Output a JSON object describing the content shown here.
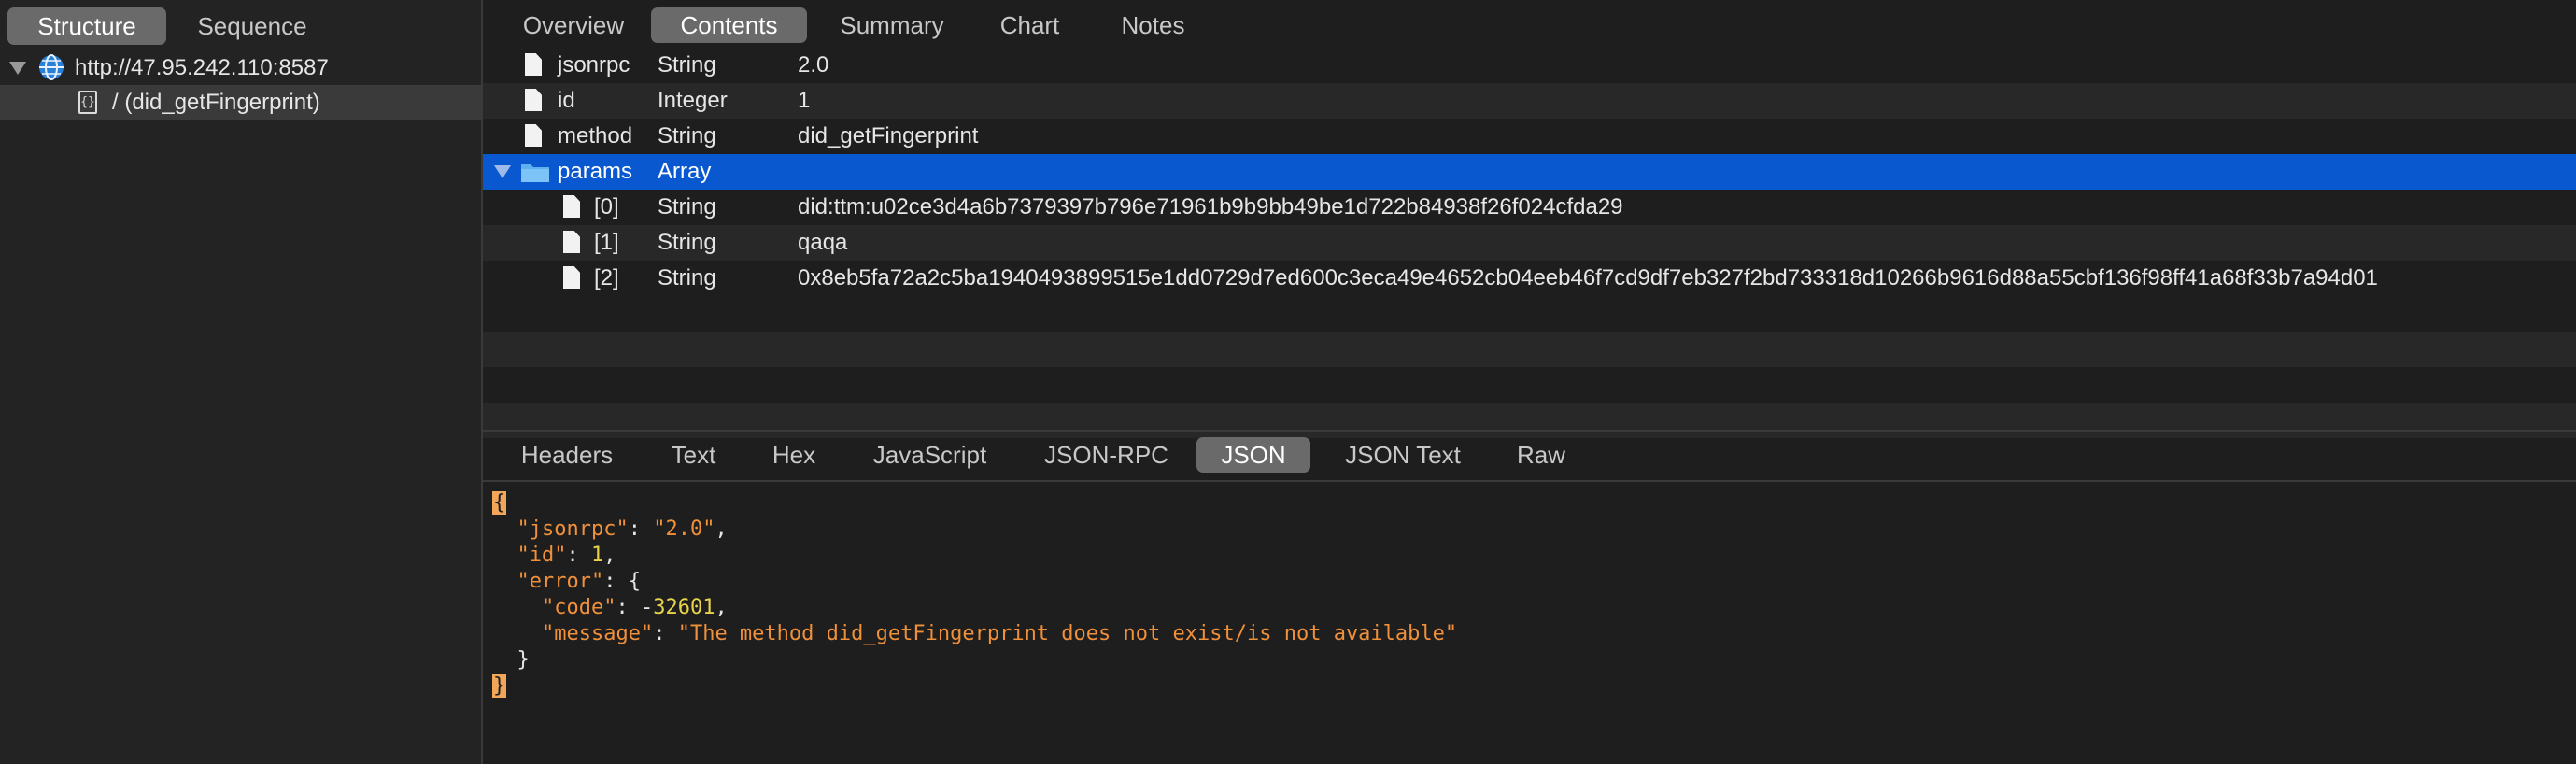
{
  "sidebar": {
    "segments": [
      "Structure",
      "Sequence"
    ],
    "host": "http://47.95.242.110:8587",
    "request_label": "/ (did_getFingerprint)",
    "request_icon": "{}"
  },
  "top_tabs": [
    "Overview",
    "Contents",
    "Summary",
    "Chart",
    "Notes"
  ],
  "table": {
    "rows": [
      {
        "name": "jsonrpc",
        "type": "String",
        "value": "2.0"
      },
      {
        "name": "id",
        "type": "Integer",
        "value": "1"
      },
      {
        "name": "method",
        "type": "String",
        "value": "did_getFingerprint"
      },
      {
        "name": "params",
        "type": "Array",
        "value": ""
      },
      {
        "name": "[0]",
        "type": "String",
        "value": "did:ttm:u02ce3d4a6b7379397b796e71961b9b9bb49be1d722b84938f26f024cfda29"
      },
      {
        "name": "[1]",
        "type": "String",
        "value": "qaqa"
      },
      {
        "name": "[2]",
        "type": "String",
        "value": "0x8eb5fa72a2c5ba1940493899515e1dd0729d7ed600c3eca49e4652cb04eeb46f7cd9df7eb327f2bd733318d10266b9616d88a55cbf136f98ff41a68f33b7a94d01"
      }
    ]
  },
  "bottom_tabs": [
    "Headers",
    "Text",
    "Hex",
    "JavaScript",
    "JSON-RPC",
    "JSON",
    "JSON Text",
    "Raw"
  ],
  "json_view": {
    "open_brace": "{",
    "close_brace": "}",
    "k_jsonrpc": "\"jsonrpc\"",
    "v_jsonrpc": "\"2.0\"",
    "k_id": "\"id\"",
    "v_id": "1",
    "k_error": "\"error\"",
    "k_code": "\"code\"",
    "v_code_sign": "-",
    "v_code": "32601",
    "k_message": "\"message\"",
    "v_message": "\"The method did_getFingerprint does not exist/is not available\""
  },
  "colors": {
    "selection": "#0a58cf",
    "active_tab": "#6a6a6a",
    "json_key": "#f0903a",
    "json_number": "#e8d34d"
  }
}
